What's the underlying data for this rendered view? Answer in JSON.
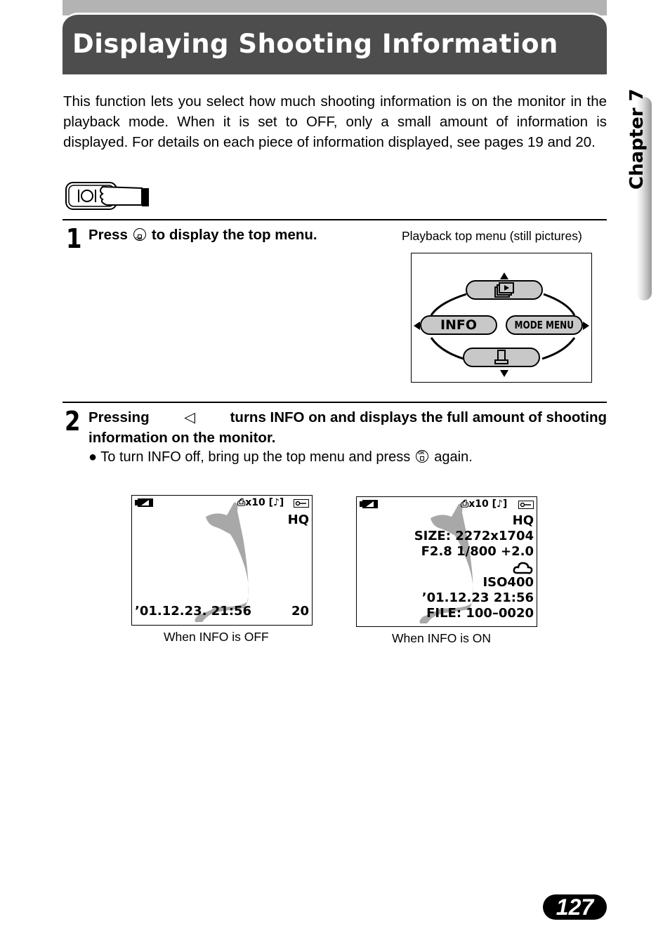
{
  "header": {
    "title": "Displaying Shooting Information"
  },
  "intro": "This function lets you select how much shooting information is on the monitor in the playback mode. When it is set to OFF, only a small amount of information is displayed. For details on each piece of information displayed, see pages 19 and 20.",
  "side_tab": {
    "label": "Chapter 7"
  },
  "step1": {
    "number": "1",
    "text_before": "Press",
    "text_after": "to display the top menu.",
    "figure_caption": "Playback top menu (still pictures)",
    "menu": {
      "top_icon": "playback-icon",
      "left_label": "INFO",
      "right_label": "MODE MENU",
      "bottom_icon": "print-icon"
    }
  },
  "step2": {
    "number": "2",
    "text_line1_before": "Pressing",
    "text_line1_after": "turns INFO on and displays the full amount of shooting",
    "text_line2": "information on the monitor.",
    "bullet_before": "To turn INFO off, bring up the top menu and press",
    "bullet_after": "again."
  },
  "screens": {
    "off": {
      "top_status": "x10",
      "quality": "HQ",
      "datetime": "’01.12.23. 21:56",
      "frame": "20",
      "caption": "When INFO is OFF"
    },
    "on": {
      "top_status": "x10",
      "lines": [
        "HQ",
        "SIZE: 2272x1704",
        "F2.8 1/800 +2.0",
        "",
        "ISO400",
        "’01.12.23  21:56",
        "FILE: 100–0020"
      ],
      "caption": "When INFO is ON"
    }
  },
  "page_number": "127"
}
